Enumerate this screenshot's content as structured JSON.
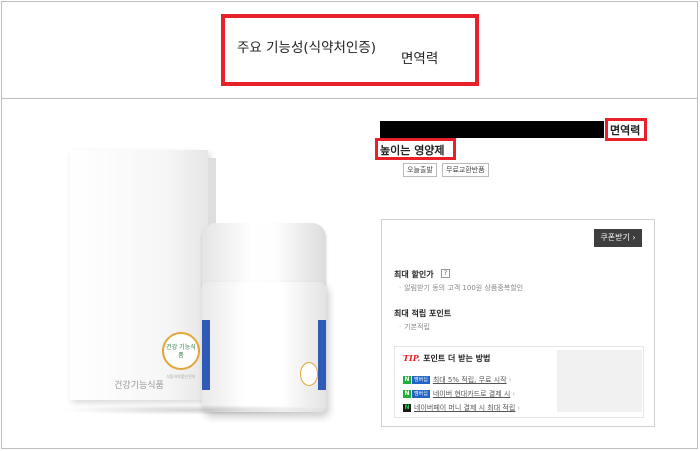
{
  "top": {
    "label": "주요 기능성(식약처인증)",
    "value": "면역력"
  },
  "product": {
    "title_highlight": "면역력",
    "subtitle_highlight": "높이는 영양제",
    "tags": [
      "오늘출발",
      "무료교환반품"
    ],
    "box_label": "건강기능식품",
    "logo_text": "건강 기능식품",
    "logo_subtext": "식품의약품안전처"
  },
  "panel": {
    "coupon_button": "쿠폰받기",
    "max_discount_title": "최대 할인가",
    "qmark": "?",
    "max_discount_sub": "알림받기 동의 고객 100원 상품중복할인",
    "max_points_title": "최대 적립 포인트",
    "max_points_sub": "기본적립",
    "tip_label": "TIP.",
    "tip_title": "포인트 더 받는 방법",
    "tips": [
      {
        "badge": "멤버십",
        "text": "최대 5% 적립, 무료 시작"
      },
      {
        "badge": "멤버십",
        "text": "네이버 현대카드로 결제 시"
      },
      {
        "badge": "",
        "text": "네이버페이 머니 결제 시 최대 적립"
      }
    ]
  },
  "colors": {
    "highlight_red": "#e8202a",
    "coupon_button_bg": "#3e3e3e",
    "naver_green": "#1fae3a",
    "membership_blue": "#1e63c5"
  }
}
